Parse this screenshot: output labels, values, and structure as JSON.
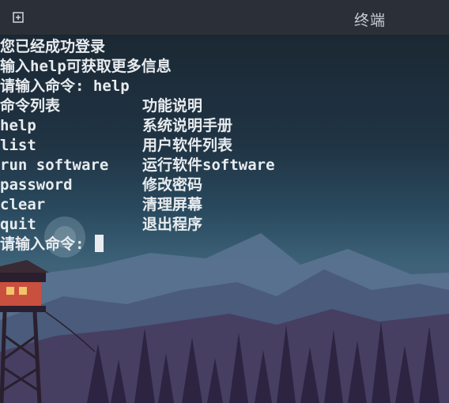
{
  "window": {
    "title": "终端",
    "new_tab_icon": "new-tab-icon"
  },
  "terminal": {
    "line1": "您已经成功登录",
    "line2": "输入help可获取更多信息",
    "prompt1": "请输入命令: help",
    "table_header": {
      "cmd": "命令列表",
      "desc": "功能说明"
    },
    "commands": [
      {
        "cmd": "help",
        "desc": "系统说明手册"
      },
      {
        "cmd": "list",
        "desc": "用户软件列表"
      },
      {
        "cmd": "run software",
        "desc": "运行软件software"
      },
      {
        "cmd": "password",
        "desc": "修改密码"
      },
      {
        "cmd": "clear",
        "desc": "清理屏幕"
      },
      {
        "cmd": "quit",
        "desc": "退出程序"
      }
    ],
    "prompt2": "请输入命令: ",
    "text_color": "#e8ecef"
  }
}
